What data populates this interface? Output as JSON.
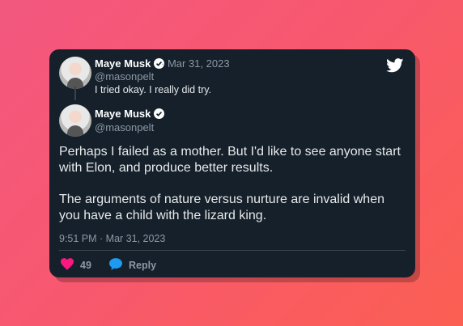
{
  "quoted_tweet": {
    "author_name": "Maye Musk",
    "date": "· Mar 31, 2023",
    "handle": "@masonpelt",
    "text": "I tried okay. I really did try."
  },
  "tweet": {
    "author_name": "Maye Musk",
    "handle": "@masonpelt",
    "paragraphs": [
      "Perhaps I failed as a mother. But I'd like to see anyone start with Elon, and produce better results.",
      "The arguments of nature versus nurture are invalid when you have a child with the lizard king."
    ],
    "timestamp": "9:51 PM · Mar 31, 2023",
    "likes": "49",
    "reply_label": "Reply"
  },
  "colors": {
    "card_bg": "#15202b",
    "like_pink": "#f91880",
    "reply_blue": "#1d9bf0",
    "muted_text": "#8b98a5"
  },
  "icons": [
    "twitter-bird-icon",
    "verified-badge-icon",
    "heart-icon",
    "reply-bubble-icon"
  ]
}
